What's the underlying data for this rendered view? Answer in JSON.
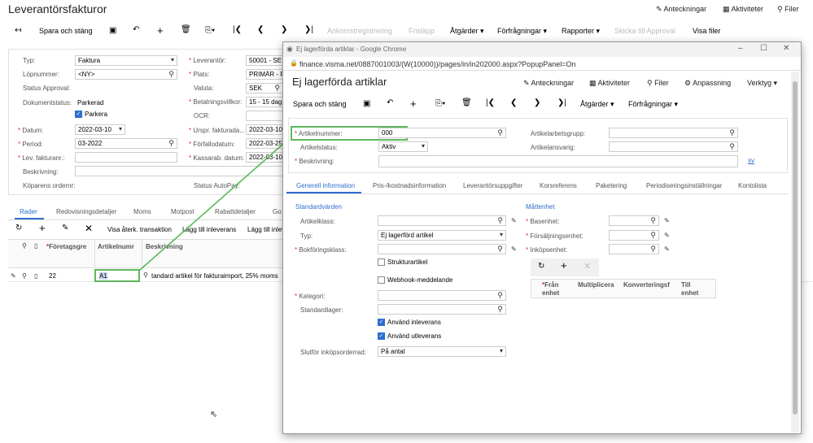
{
  "page": {
    "title": "Leverantörsfakturor",
    "notes": "Anteckningar",
    "activities": "Aktiviteter",
    "files": "Filer"
  },
  "toolbar": {
    "save_close": "Spara och stäng",
    "receipt": "Ankomstregistrering",
    "release": "Frisläpp",
    "actions": "Åtgärder",
    "inquiries": "Förfrågningar",
    "reports": "Rapporter",
    "send_approval": "Skicka till Approval",
    "show_files": "Visa filer"
  },
  "form": {
    "type_label": "Typ:",
    "type_value": "Faktura",
    "refnbr_label": "Löpnummer:",
    "refnbr_value": "<NY>",
    "status_approval_label": "Status Approval:",
    "docstatus_label": "Dokumentstatus:",
    "docstatus_value": "Parkerad",
    "park_label": "Parkera",
    "date_label": "Datum:",
    "date_value": "2022-03-10",
    "period_label": "Period:",
    "period_value": "03-2022",
    "vendorref_label": "Lev. fakturanr.:",
    "desc_label": "Beskrivning:",
    "payer_order_label": "Köparens ordernr:",
    "vendor_label": "Leverantör:",
    "vendor_value": "50001 - SE",
    "location_label": "Plats:",
    "location_value": "PRIMÄR - P",
    "currency_label": "Valuta:",
    "currency_value": "SEK",
    "terms_label": "Betalningsvillkor:",
    "terms_value": "15 - 15 daga",
    "ocr_label": "OCR:",
    "origdate_label": "Urspr. fakturada...",
    "origdate_value": "2022-03-10",
    "duedate_label": "Förfallodatum:",
    "duedate_value": "2022-03-25",
    "cashdate_label": "Kassarab. datum:",
    "cashdate_value": "2022-03-10",
    "autopay_label": "Status AutoPay:"
  },
  "tabs": [
    "Rader",
    "Redovisningsdetaljer",
    "Moms",
    "Motpost",
    "Rabattdetaljer",
    "Go"
  ],
  "grid": {
    "toolbar": {
      "show_trans": "Visa återk. transaktion",
      "add_receipt": "Lägg till inleverans",
      "add_receipt2": "Lägg till inlev"
    },
    "headers": {
      "company": "Företagsgre",
      "item": "Artikelnumr",
      "desc": "Beskrivning"
    },
    "row": {
      "company": "22",
      "item": "A1",
      "desc": "tandard artikel för fakturaimport, 25% moms"
    }
  },
  "popup": {
    "window_title": "Ej lagerförda artiklar - Google Chrome",
    "url": "finance.visma.net/0887001003/(W(10000))/pages/in/in202000.aspx?PopupPanel=On",
    "title": "Ej lagerförda artiklar",
    "notes": "Anteckningar",
    "activities": "Aktiviteter",
    "files": "Filer",
    "customize": "Anpassning",
    "tools": "Verktyg",
    "save_close": "Spara och stäng",
    "actions": "Åtgärder",
    "inquiries": "Förfrågningar",
    "item_label": "Artikelnummer:",
    "item_value": "000",
    "status_label": "Artikelstatus:",
    "status_value": "Aktiv",
    "desc_label": "Beskrivning:",
    "workgroup_label": "Artikelarbetsgrupp:",
    "owner_label": "Artikelansvarig:",
    "lang": "sv",
    "tabs": [
      "Generell information",
      "Pris-/kostnadsinformation",
      "Leverantörsuppgifter",
      "Korsreferens",
      "Paketering",
      "Periodiseringsinställningar",
      "Kontolista"
    ],
    "defaults_header": "Standardvärden",
    "class_label": "Artikelklass:",
    "type_label": "Typ:",
    "type_value": "Ej lagerförd artikel",
    "posting_label": "Bokföringsklass:",
    "structure_label": "Strukturartikel",
    "webhook_label": "Webhook-meddelande",
    "category_label": "Kategori:",
    "warehouse_label": "Standardlager:",
    "use_receipt_label": "Använd inleverans",
    "use_shipment_label": "Använd utleverans",
    "complete_po_label": "Slutför inköpsorderrad:",
    "complete_po_value": "På antal",
    "uom_header": "Måttenhet",
    "base_unit_label": "Basenhet:",
    "sales_unit_label": "Försäljningsenhet:",
    "purchase_unit_label": "Inköpsenhet:",
    "conv_headers": [
      "Från enhet",
      "Multiplicera",
      "Konverteringsf",
      "Till enhet"
    ]
  },
  "colors": {
    "accent": "#2d6ecf",
    "highlight": "#5cb85c"
  }
}
